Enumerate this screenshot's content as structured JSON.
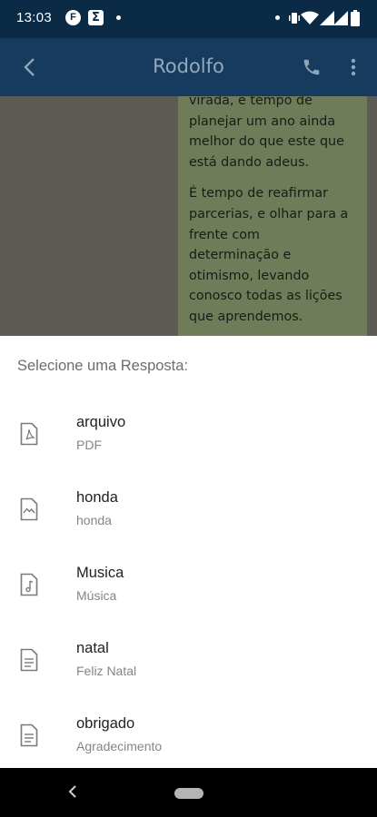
{
  "status_bar": {
    "time": "13:03",
    "notification_icons": [
      "f-app-icon",
      "sigma-app-icon"
    ],
    "system_icons": [
      "dot-icon",
      "vibrate-icon",
      "wifi-icon",
      "signal-icon",
      "signal-icon",
      "battery-icon"
    ],
    "background": "#0b2a46"
  },
  "app_bar": {
    "title": "Rodolfo",
    "background": "#173b5e",
    "icons": [
      "back-arrow-icon",
      "phone-icon",
      "more-vert-icon"
    ]
  },
  "chat": {
    "message_lines_1": [
      "virada, e tempo de",
      "planejar um ano ainda",
      "melhor do que este que",
      "está dando adeus."
    ],
    "message_lines_2": [
      "É tempo de reafirmar",
      "parcerias, e olhar para a",
      "frente com",
      "determinação e",
      "otimismo, levando",
      "conosco todas as lições",
      "que aprendemos."
    ]
  },
  "sheet": {
    "title": "Selecione uma Resposta:",
    "items": [
      {
        "name": "arquivo",
        "subtitle": "PDF",
        "icon": "pdf-file-icon"
      },
      {
        "name": "honda",
        "subtitle": "honda",
        "icon": "image-file-icon"
      },
      {
        "name": "Musica",
        "subtitle": "Música",
        "icon": "music-file-icon"
      },
      {
        "name": "natal",
        "subtitle": "Feliz Natal",
        "icon": "text-file-icon"
      },
      {
        "name": "obrigado",
        "subtitle": "Agradecimento",
        "icon": "text-file-icon"
      }
    ]
  },
  "nav_bar": {
    "icons": [
      "nav-back-icon",
      "home-pill-icon"
    ]
  }
}
